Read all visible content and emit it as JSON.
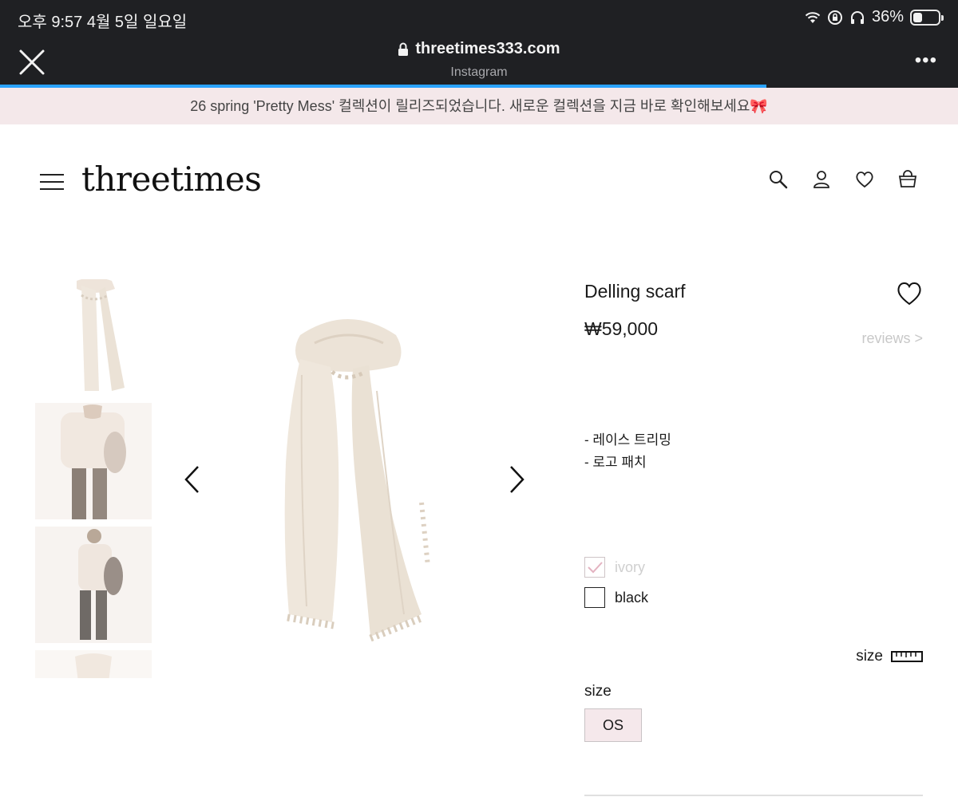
{
  "status_bar": {
    "time": "오후 9:57   4월 5일 일요일",
    "battery": "36%",
    "battery_level": 0.36
  },
  "browser": {
    "url": "threetimes333.com",
    "subtitle": "Instagram",
    "more_label": "•••",
    "load_progress": 0.8
  },
  "promo": {
    "text": "26 spring 'Pretty Mess' 컬렉션이 릴리즈되었습니다. 새로운 컬렉션을 지금 바로 확인해보세요🎀"
  },
  "header": {
    "logo": "threetimes"
  },
  "product": {
    "name": "Delling scarf",
    "price": "₩59,000",
    "reviews_link": "reviews >",
    "features": [
      "- 레이스 트리밍",
      "- 로고 패치"
    ],
    "colors": [
      {
        "label": "ivory",
        "checked": true,
        "disabled": true
      },
      {
        "label": "black",
        "checked": false,
        "disabled": false
      }
    ],
    "size_guide_label": "size",
    "size_label": "size",
    "size_option": "OS"
  },
  "colors": {
    "status_bg": "#1f2023",
    "promo_bg": "#f4e8ea",
    "accent_blue": "#2aa3ff",
    "size_bg": "#f5e8eb"
  },
  "icons": [
    "close-icon",
    "lock-icon",
    "search-icon",
    "user-icon",
    "heart-icon",
    "bag-icon",
    "chevron-left-icon",
    "chevron-right-icon",
    "ruler-icon",
    "wifi-icon",
    "headphones-icon"
  ]
}
